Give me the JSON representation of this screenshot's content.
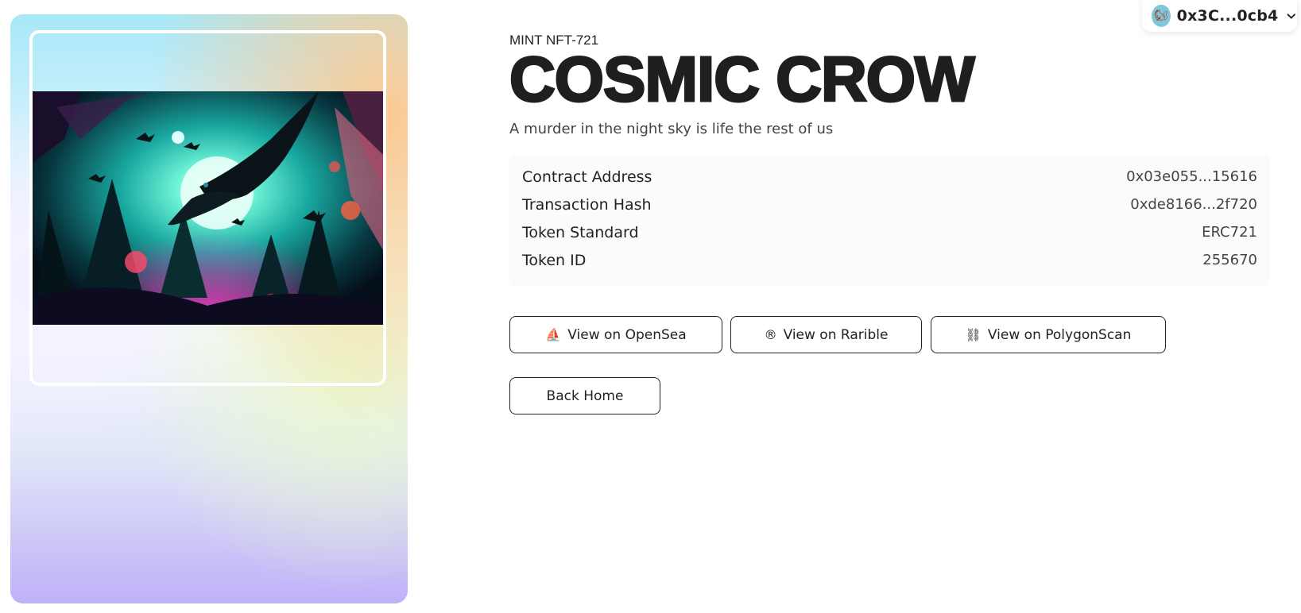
{
  "wallet": {
    "address": "0x3C...0cb4",
    "avatar_icon": "squirrel-avatar-icon",
    "chevron_icon": "chevron-down-icon"
  },
  "nft": {
    "eyebrow": "MINT NFT-721",
    "title": "COSMIC CROW",
    "description": "A murder in the night sky is life the rest of us"
  },
  "details": [
    {
      "label": "Contract Address",
      "value": "0x03e055...15616"
    },
    {
      "label": "Transaction Hash",
      "value": "0xde8166...2f720"
    },
    {
      "label": "Token Standard",
      "value": "ERC721"
    },
    {
      "label": "Token ID",
      "value": "255670"
    }
  ],
  "actions": {
    "opensea": {
      "icon": "⛵",
      "label": "View on OpenSea"
    },
    "rarible": {
      "icon": "®",
      "label": "View on Rarible"
    },
    "polygon": {
      "icon": "⛓",
      "label": "View on PolygonScan"
    },
    "home": {
      "label": "Back Home"
    }
  },
  "colors": {
    "text": "#222222",
    "border": "#222222",
    "card_gradient_top": "#a8e8f8",
    "card_gradient_bottom": "#c0b0f8"
  }
}
